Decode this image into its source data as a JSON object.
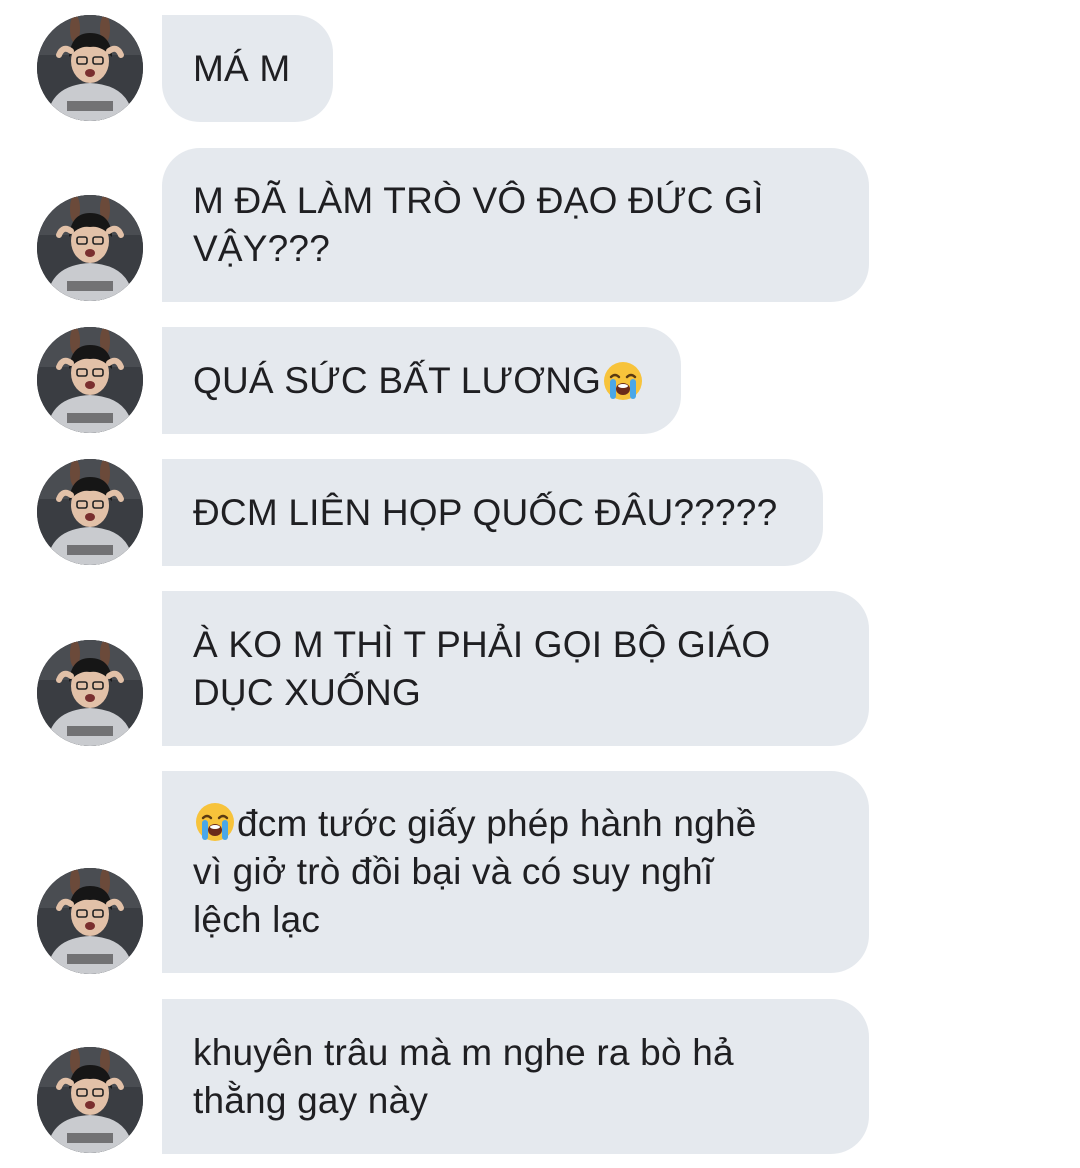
{
  "messages": [
    {
      "text": "MÁ M",
      "emoji_after": null,
      "emoji_before": null
    },
    {
      "text": "M ĐÃ LÀM TRÒ VÔ ĐẠO ĐỨC GÌ\nVẬY???",
      "emoji_after": null,
      "emoji_before": null
    },
    {
      "text": "QUÁ SỨC BẤT LƯƠNG",
      "emoji_after": "loudly-crying-face-emoji",
      "emoji_before": null
    },
    {
      "text": "ĐCM LIÊN HỌP QUỐC ĐÂU?????",
      "emoji_after": null,
      "emoji_before": null
    },
    {
      "text": "À KO M THÌ T PHẢI GỌI BỘ GIÁO\nDỤC XUỐNG",
      "emoji_after": null,
      "emoji_before": null
    },
    {
      "text": "đcm tước giấy phép hành nghề\nvì giở trò đồi bại và có suy nghĩ\nlệch lạc",
      "emoji_after": null,
      "emoji_before": "loudly-crying-face-emoji"
    },
    {
      "text": "khuyên trâu mà m nghe ra bò hả\nthằng gay này",
      "emoji_after": null,
      "emoji_before": null
    }
  ],
  "colors": {
    "bubble_bg": "#e5e9ee",
    "text": "#1f1f22",
    "background": "#ffffff"
  },
  "sender_avatar": "avatar-icon"
}
